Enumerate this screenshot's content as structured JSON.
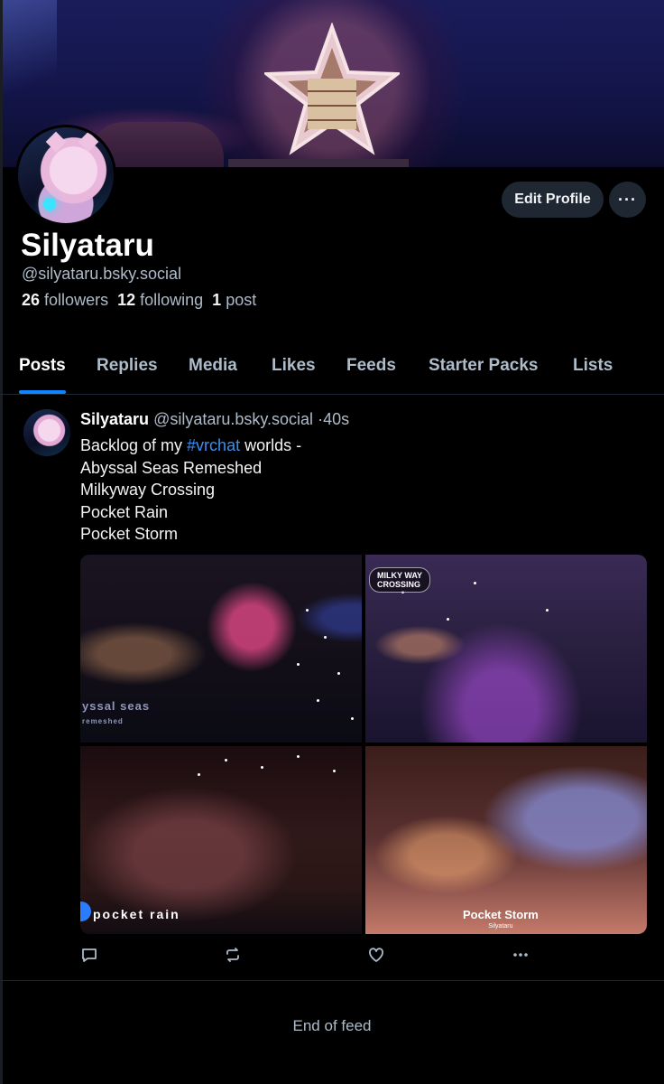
{
  "profile": {
    "display_name": "Silyataru",
    "handle": "@silyataru.bsky.social",
    "followers_count": "26",
    "followers_label": "followers",
    "following_count": "12",
    "following_label": "following",
    "posts_count": "1",
    "posts_label": "post",
    "edit_button": "Edit Profile",
    "more_button": "···"
  },
  "tabs": [
    {
      "label": "Posts",
      "active": true
    },
    {
      "label": "Replies",
      "active": false
    },
    {
      "label": "Media",
      "active": false
    },
    {
      "label": "Likes",
      "active": false
    },
    {
      "label": "Feeds",
      "active": false
    },
    {
      "label": "Starter Packs",
      "active": false
    },
    {
      "label": "Lists",
      "active": false
    }
  ],
  "post": {
    "author_name": "Silyataru",
    "author_handle": "@silyataru.bsky.social",
    "separator": "·",
    "time": "40s",
    "text_prefix": "Backlog of my ",
    "hashtag": "#vrchat",
    "text_suffix": " worlds -",
    "lines": [
      "Abyssal Seas Remeshed",
      "Milkyway Crossing",
      "Pocket Rain",
      "Pocket Storm"
    ],
    "images": [
      {
        "label": "yssal seas",
        "sublabel": "remeshed"
      },
      {
        "label": "MILKY WAY",
        "sublabel": "CROSSING"
      },
      {
        "label": "pocket rain"
      },
      {
        "label": "Pocket Storm",
        "sublabel": "Silyataru"
      }
    ],
    "actions": [
      "reply-icon",
      "repost-icon",
      "like-icon",
      "more-icon"
    ]
  },
  "feed": {
    "end_text": "End of feed"
  }
}
